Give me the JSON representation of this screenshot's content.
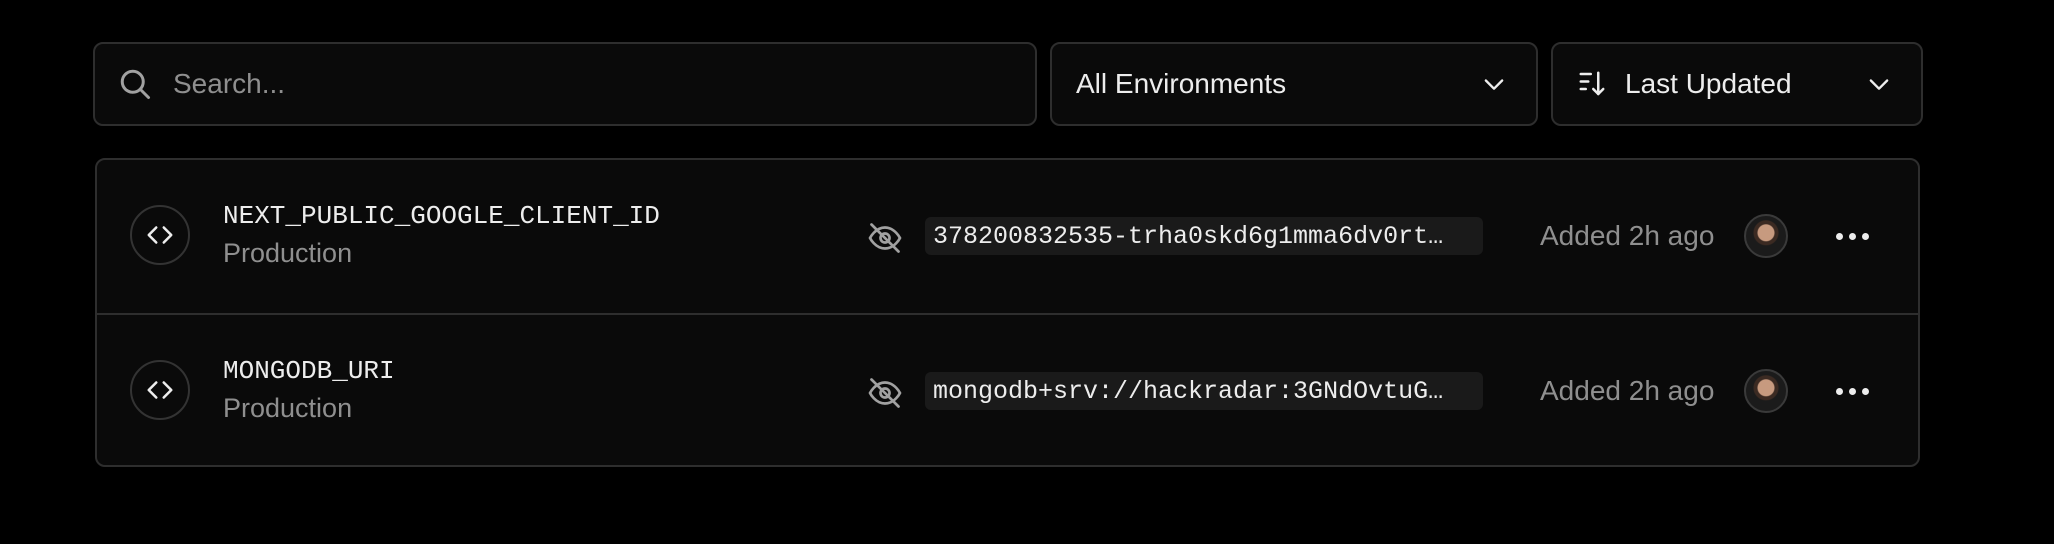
{
  "search": {
    "placeholder": "Search..."
  },
  "filters": {
    "environment": {
      "selected": "All Environments"
    },
    "sort": {
      "selected": "Last Updated"
    }
  },
  "variables": [
    {
      "key": "NEXT_PUBLIC_GOOGLE_CLIENT_ID",
      "environment": "Production",
      "value": "378200832535-trha0skd6g1mma6dv0rt…",
      "added": "Added 2h ago"
    },
    {
      "key": "MONGODB_URI",
      "environment": "Production",
      "value": "mongodb+srv://hackradar:3GNdOvtuG…",
      "added": "Added 2h ago"
    }
  ],
  "icons": {
    "search": "search-icon",
    "chevron": "chevron-down-icon",
    "sort": "sort-descending-icon",
    "code": "code-brackets-icon",
    "hidden": "eye-off-icon",
    "more": "more-horizontal-icon"
  },
  "colors": {
    "background": "#000000",
    "surface": "#0a0a0a",
    "border": "#2e2e2e",
    "text": "#ededed",
    "muted": "#8f8f8f"
  }
}
